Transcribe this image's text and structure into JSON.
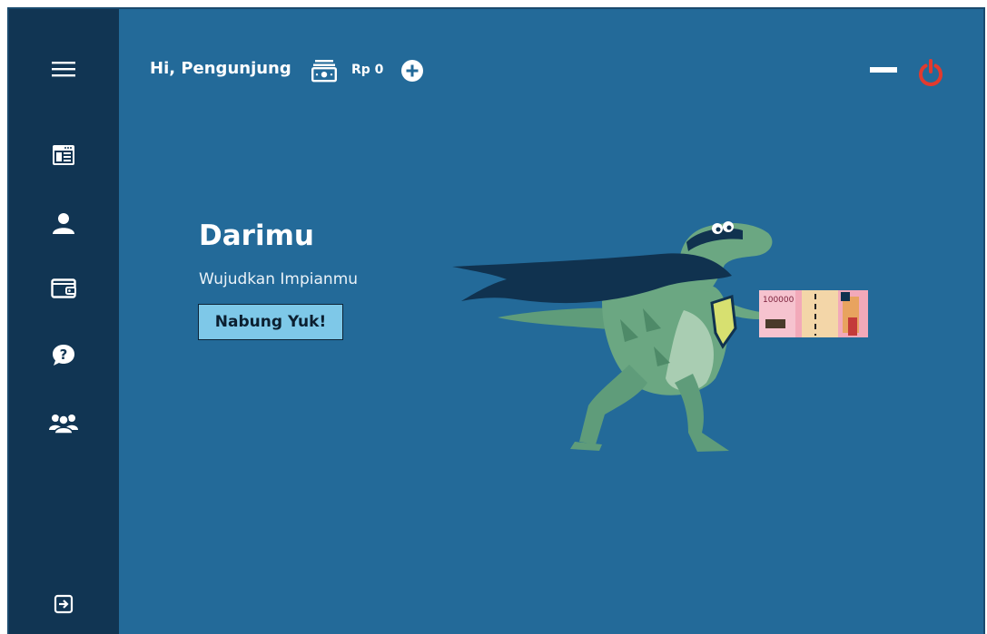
{
  "header": {
    "greeting": "Hi, Pengunjung",
    "balance": "Rp 0"
  },
  "hero": {
    "title": "Darimu",
    "subtitle": "Wujudkan Impianmu",
    "cta_label": "Nabung Yuk!"
  },
  "banknote": {
    "value_text": "100000"
  },
  "colors": {
    "sidebar": "#113553",
    "main_background": "#236a99",
    "cta_background": "#7ec8e8",
    "power_icon": "#e23a2e"
  },
  "icons": {
    "menu": "hamburger-icon",
    "dashboard": "calendar-icon",
    "profile": "user-icon",
    "wallet": "wallet-icon",
    "help": "question-icon",
    "community": "group-icon",
    "logout": "sign-out-icon",
    "money": "money-icon",
    "add": "plus-circle-icon",
    "minimize": "minimize-icon",
    "power": "power-icon"
  }
}
